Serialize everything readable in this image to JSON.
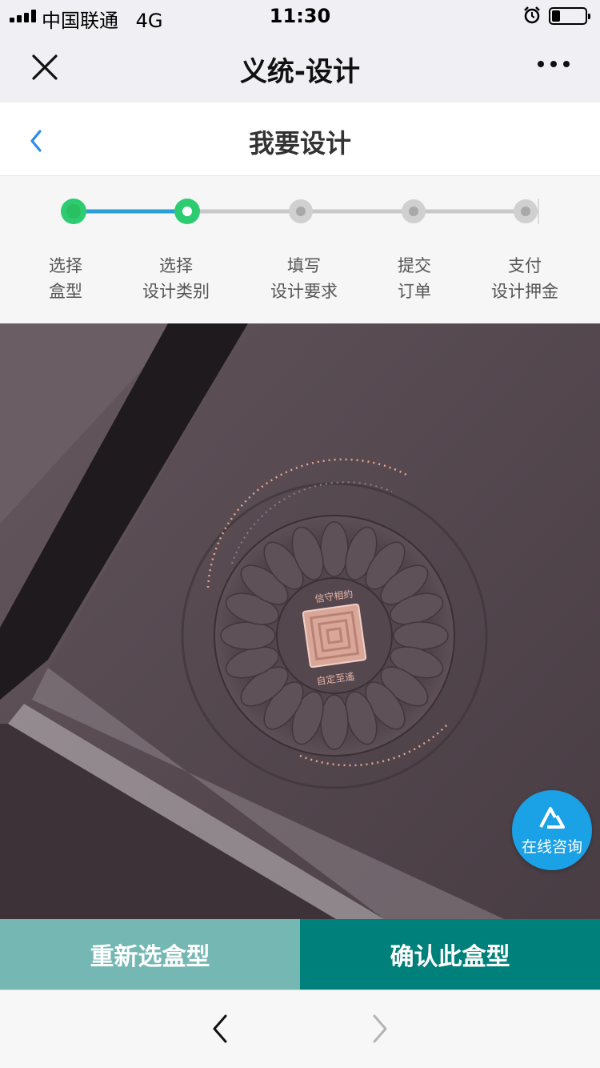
{
  "status_bar": {
    "carrier": "中国联通",
    "network": "4G",
    "time": "11:30",
    "battery_level": 0.25
  },
  "wechat_nav": {
    "title": "义统-设计",
    "close_icon": "close-icon",
    "more_icon": "more-dots-icon"
  },
  "page_header": {
    "title": "我要设计",
    "back_icon": "chevron-left-icon"
  },
  "steps": {
    "current_step": 2,
    "items": [
      {
        "line1": "选择",
        "line2": "盒型",
        "state": "done"
      },
      {
        "line1": "选择",
        "line2": "设计类别",
        "state": "current"
      },
      {
        "line1": "填写",
        "line2": "设计要求",
        "state": "pending"
      },
      {
        "line1": "提交",
        "line2": "订单",
        "state": "pending"
      },
      {
        "line1": "支付",
        "line2": "设计押金",
        "state": "pending"
      }
    ],
    "colors": {
      "done": "#2ecc71",
      "line_done": "#2a9fd6",
      "pending": "#c8c8c8"
    }
  },
  "hero": {
    "image": "dark-purple-gift-box-with-embossed-seal-photo",
    "seal_top_text": "信守相約",
    "seal_bottom_text": "自定至遙"
  },
  "consult_button": {
    "label": "在线咨询",
    "icon": "consult-logo-icon",
    "color": "#1aa1e6"
  },
  "actions": {
    "reselect_label": "重新选盒型",
    "confirm_label": "确认此盒型",
    "reselect_color": "#74b7b3",
    "confirm_color": "#00807a"
  },
  "browser_toolbar": {
    "back_icon": "chevron-left-icon",
    "forward_icon": "chevron-right-icon"
  }
}
